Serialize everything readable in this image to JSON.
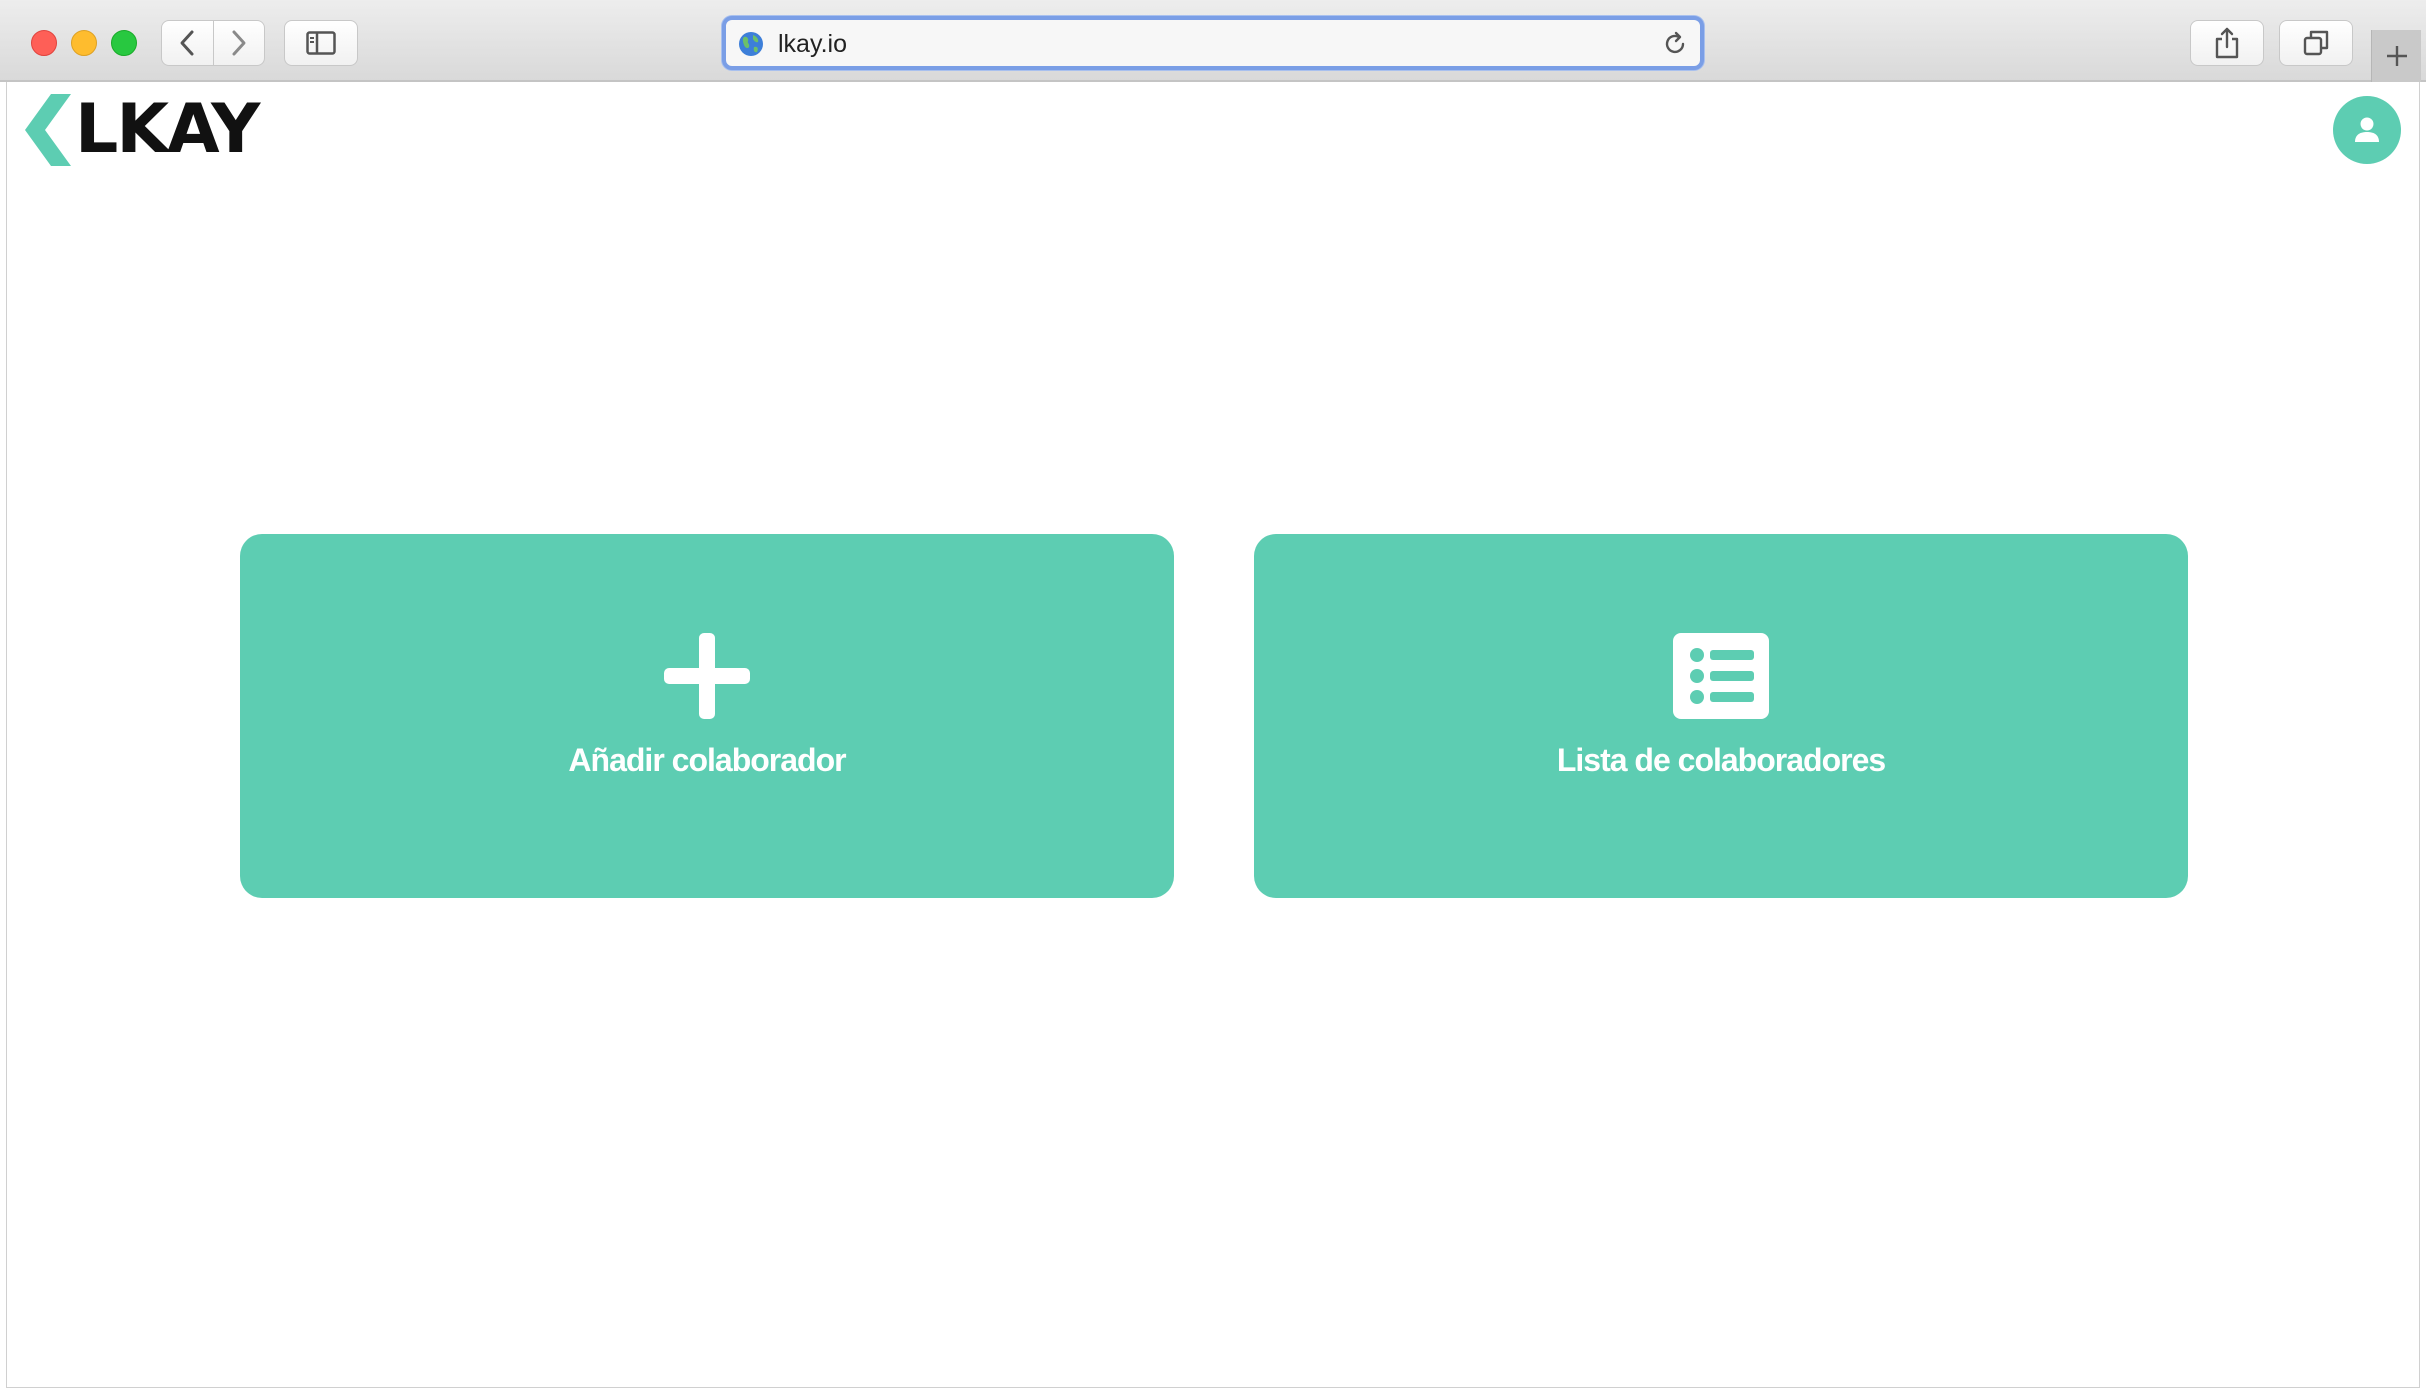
{
  "browser": {
    "url": "lkay.io",
    "icons": {
      "back": "chevron-left-icon",
      "forward": "chevron-right-icon",
      "sidebar": "sidebar-icon",
      "site": "globe-icon",
      "reload": "reload-icon",
      "share": "share-icon",
      "tabs": "tabs-overview-icon",
      "new_tab": "plus-icon"
    }
  },
  "header": {
    "logo_text": "LKAY",
    "brand_color": "#5dcdb2",
    "avatar_icon": "user-icon"
  },
  "cards": [
    {
      "label": "Añadir colaborador",
      "icon": "plus-icon"
    },
    {
      "label": "Lista de colaboradores",
      "icon": "list-icon"
    }
  ]
}
